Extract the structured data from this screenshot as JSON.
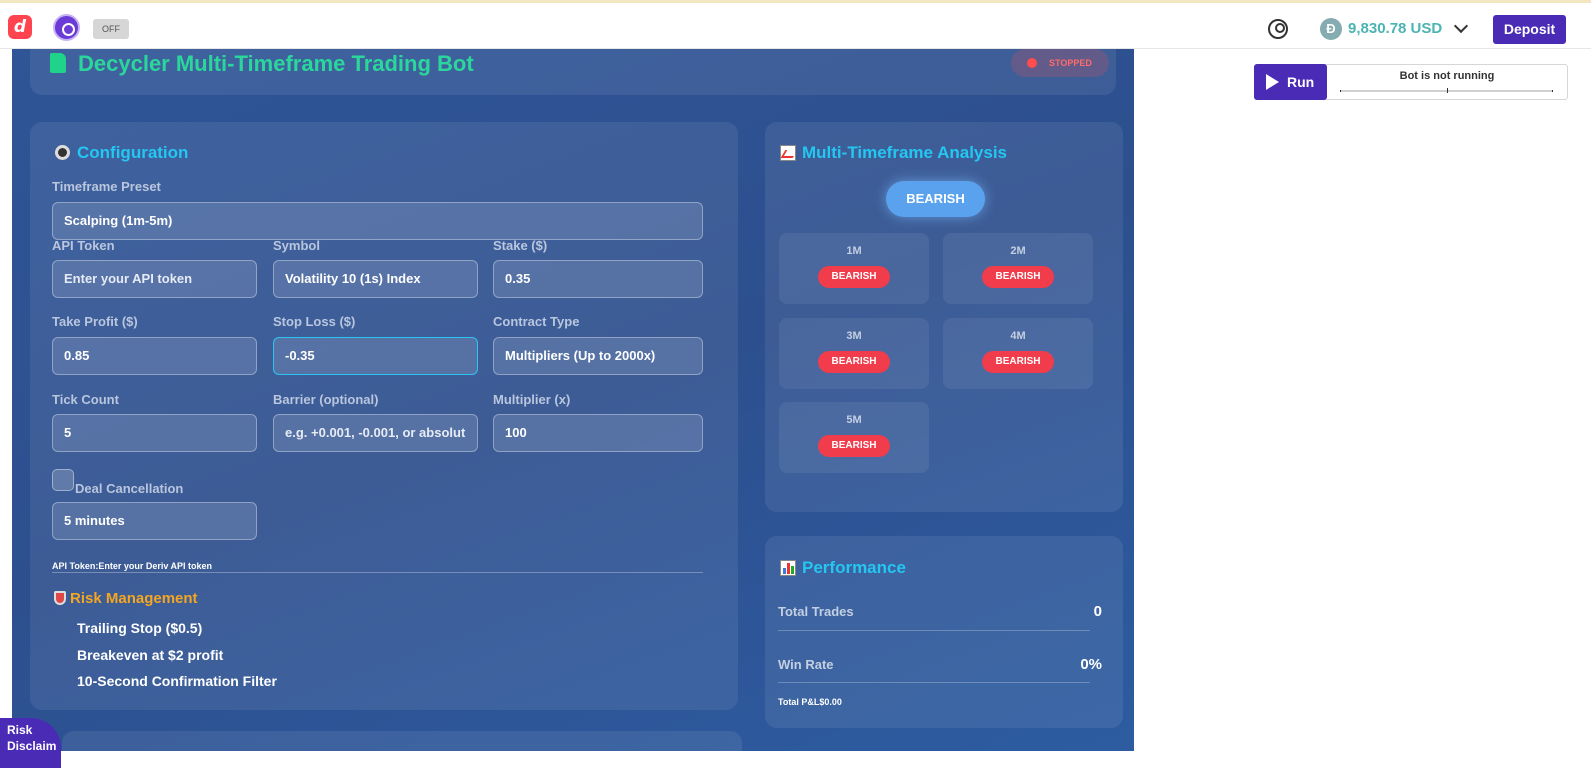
{
  "topbar": {
    "logo_letter": "d",
    "bot_toggle_label": "OFF",
    "currency_symbol": "Đ",
    "balance": "9,830.78 USD",
    "deposit_label": "Deposit"
  },
  "app": {
    "title": "Decycler Multi-Timeframe Trading Bot",
    "status": "STOPPED"
  },
  "config": {
    "title": "Configuration",
    "preset_label": "Timeframe Preset",
    "preset_value": "Scalping (1m-5m)",
    "api_token_label": "API Token",
    "api_token_placeholder": "Enter your API token",
    "symbol_label": "Symbol",
    "symbol_value": "Volatility 10 (1s) Index",
    "stake_label": "Stake ($)",
    "stake_value": "0.35",
    "take_profit_label": "Take Profit ($)",
    "take_profit_value": "0.85",
    "stop_loss_label": "Stop Loss ($)",
    "stop_loss_value": "-0.35",
    "contract_type_label": "Contract Type",
    "contract_type_value": "Multipliers (Up to 2000x)",
    "tick_count_label": "Tick Count",
    "tick_count_value": "5",
    "barrier_label": "Barrier (optional)",
    "barrier_placeholder": "e.g. +0.001, -0.001, or absolut",
    "multiplier_label": "Multiplier (x)",
    "multiplier_value": "100",
    "deal_cancellation_label": "Deal Cancellation",
    "deal_cancellation_value": "5 minutes",
    "api_hint": "API Token:Enter your Deriv API token"
  },
  "risk": {
    "title": "Risk Management",
    "items": [
      "Trailing Stop ($0.5)",
      "Breakeven at $2 profit",
      "10-Second Confirmation Filter"
    ]
  },
  "analysis": {
    "title": "Multi-Timeframe Analysis",
    "overall": "BEARISH",
    "timeframes": [
      {
        "label": "1M",
        "signal": "BEARISH"
      },
      {
        "label": "2M",
        "signal": "BEARISH"
      },
      {
        "label": "3M",
        "signal": "BEARISH"
      },
      {
        "label": "4M",
        "signal": "BEARISH"
      },
      {
        "label": "5M",
        "signal": "BEARISH"
      }
    ]
  },
  "performance": {
    "title": "Performance",
    "total_trades_label": "Total Trades",
    "total_trades_value": "0",
    "win_rate_label": "Win Rate",
    "win_rate_value": "0%",
    "total_pl": "Total P&L$0.00"
  },
  "run_panel": {
    "run_label": "Run",
    "status": "Bot is not running"
  },
  "footer": {
    "risk_badge": "Risk Disclaim"
  }
}
